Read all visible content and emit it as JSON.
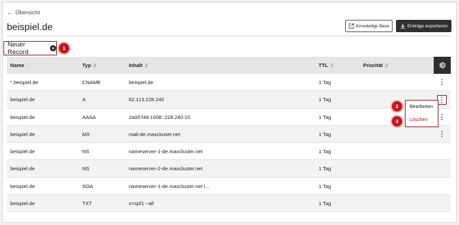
{
  "nav": {
    "back_label": "Übersicht"
  },
  "page": {
    "title": "beispiel.de"
  },
  "toolbar": {
    "kb_label": "Knowledge Base",
    "export_label": "Einträge exportieren"
  },
  "new_record_label": "Neuer Record",
  "badges": [
    "1",
    "2",
    "3"
  ],
  "table": {
    "headers": {
      "name": "Name",
      "type": "Typ",
      "content": "Inhalt",
      "ttl": "TTL",
      "priority": "Priorität"
    },
    "rows": [
      {
        "name": "*.beispiel.de",
        "type": "CNAME",
        "content": "beispiel.de",
        "ttl": "1 Tag",
        "priority": ""
      },
      {
        "name": "beispiel.de",
        "type": "A",
        "content": "62.113.228.240",
        "ttl": "1 Tag",
        "priority": ""
      },
      {
        "name": "beispiel.de",
        "type": "AAAA",
        "content": "2a00:f48:1008::228:240:10",
        "ttl": "1 Tag",
        "priority": ""
      },
      {
        "name": "beispiel.de",
        "type": "MX",
        "content": "mail-de.maxcluster.net",
        "ttl": "1 Tag",
        "priority": ""
      },
      {
        "name": "beispiel.de",
        "type": "NS",
        "content": "nameserver-1-de.maxcluster.net",
        "ttl": "1 Tag",
        "priority": ""
      },
      {
        "name": "beispiel.de",
        "type": "NS",
        "content": "nameserver-2-de.maxcluster.net",
        "ttl": "1 Tag",
        "priority": ""
      },
      {
        "name": "beispiel.de",
        "type": "SOA",
        "content": "nameserver-1-de.maxcluster.net i...",
        "ttl": "1 Tag",
        "priority": ""
      },
      {
        "name": "beispiel.de",
        "type": "TXT",
        "content": "v=spf1 ~all",
        "ttl": "1 Tag",
        "priority": ""
      }
    ]
  },
  "context_menu": {
    "edit_label": "Bearbeiten",
    "delete_label": "Löschen"
  },
  "colors": {
    "accent": "#8b1f1f",
    "badge": "#c0181e",
    "dark": "#2f2f2f"
  }
}
